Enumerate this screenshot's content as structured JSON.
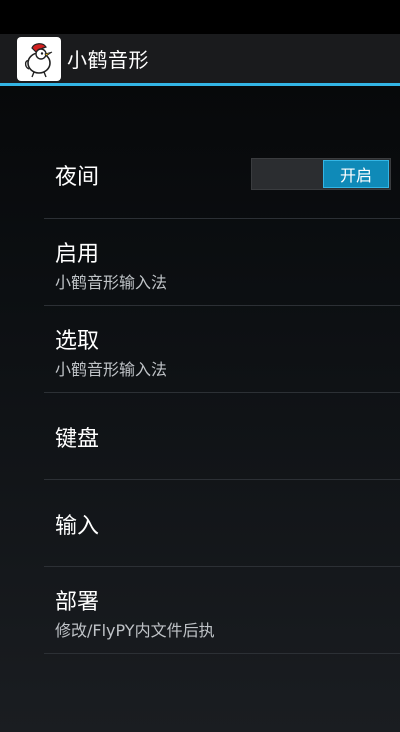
{
  "app": {
    "title": "小鹤音形",
    "icon": "crane-bird-icon"
  },
  "colors": {
    "accent": "#33b5e5",
    "toggle_on": "#0f8ab8",
    "divider": "#2c3035"
  },
  "settings": {
    "items": [
      {
        "title": "夜间",
        "toggle_label": "开启",
        "toggle_state": "on"
      },
      {
        "title": "启用",
        "summary": "小鹤音形输入法"
      },
      {
        "title": "选取",
        "summary": "小鹤音形输入法"
      },
      {
        "title": "键盘"
      },
      {
        "title": "输入"
      },
      {
        "title": "部署",
        "summary": "修改/FlyPY内文件后执"
      }
    ]
  }
}
